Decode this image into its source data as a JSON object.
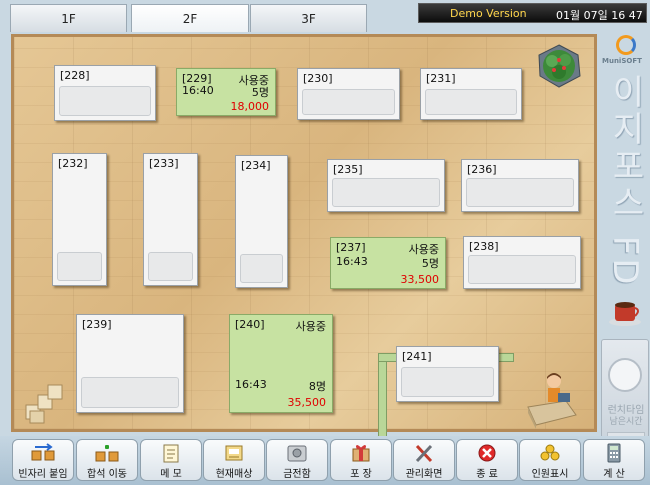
{
  "floor_tabs": [
    "1F",
    "2F",
    "3F"
  ],
  "status_bar": {
    "mode": "Demo Version",
    "datetime": "01월 07일 16 47"
  },
  "tables": [
    {
      "num": "[228]"
    },
    {
      "num": "[229]",
      "status": "사용중",
      "time": "16:40",
      "guests": "5명",
      "amount": "18,000"
    },
    {
      "num": "[230]"
    },
    {
      "num": "[231]"
    },
    {
      "num": "[232]"
    },
    {
      "num": "[233]"
    },
    {
      "num": "[234]"
    },
    {
      "num": "[235]"
    },
    {
      "num": "[236]"
    },
    {
      "num": "[237]",
      "status": "사용중",
      "time": "16:43",
      "guests": "5명",
      "amount": "33,500"
    },
    {
      "num": "[238]"
    },
    {
      "num": "[239]"
    },
    {
      "num": "[240]",
      "status": "사용중",
      "time": "16:43",
      "guests": "8명",
      "amount": "35,500"
    },
    {
      "num": "[241]"
    }
  ],
  "side_panel": {
    "brand": "MuniSOFT",
    "title": "이지포스 FD",
    "lunch_time": "런치타임",
    "lunch_sub": "남은시간"
  },
  "toolbar": [
    {
      "label": "빈자리 붙임",
      "icon": "join-tables-icon"
    },
    {
      "label": "합석 이동",
      "icon": "move-seats-icon"
    },
    {
      "label": "메 모",
      "icon": "memo-icon"
    },
    {
      "label": "현재매상",
      "icon": "current-sales-icon"
    },
    {
      "label": "금전함",
      "icon": "cash-drawer-icon"
    },
    {
      "label": "포 장",
      "icon": "package-icon"
    },
    {
      "label": "관리화면",
      "icon": "tools-icon"
    },
    {
      "label": "종 료",
      "icon": "close-icon"
    },
    {
      "label": "인원표시",
      "icon": "coins-icon"
    },
    {
      "label": "계 산",
      "icon": "calculator-icon"
    }
  ],
  "colors": {
    "used_table": "#c7e2a2",
    "amount": "#e00000",
    "demo_text": "#ffd64d"
  }
}
